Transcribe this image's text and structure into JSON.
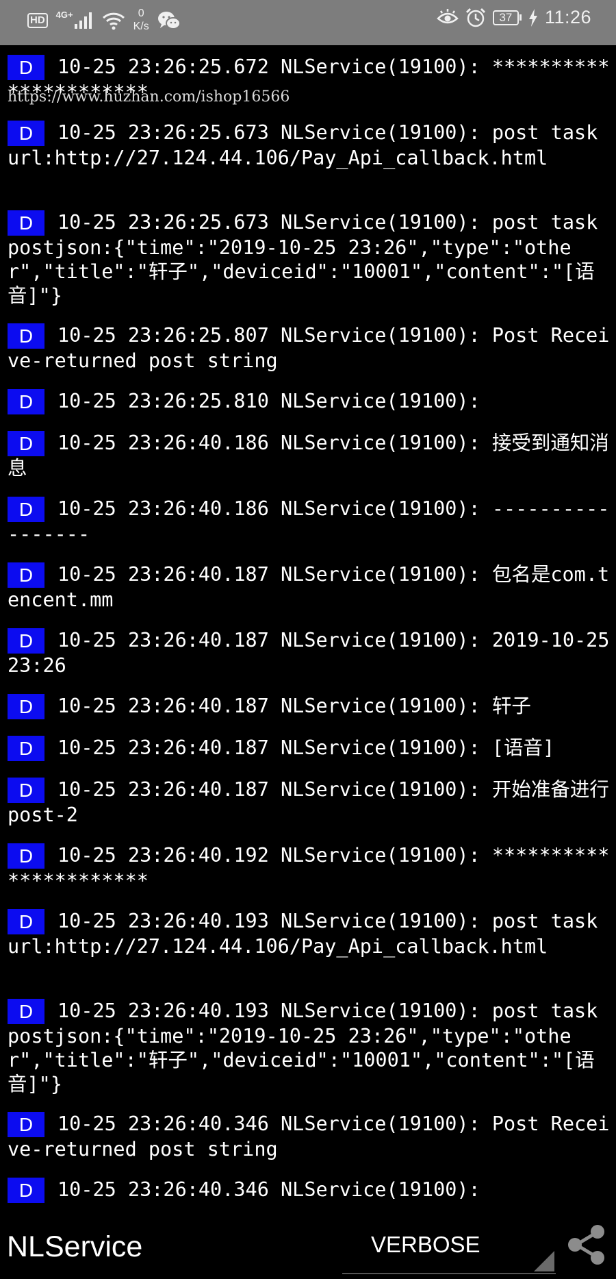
{
  "status_bar": {
    "hd_badge": "HD",
    "network_label": "4G+",
    "speed_value": "0",
    "speed_unit": "K/s",
    "battery": "37",
    "time": "11:26",
    "icons": [
      "signal-icon",
      "wifi-icon",
      "wechat-icon",
      "eye-comfort-icon",
      "alarm-icon",
      "battery-icon",
      "charging-icon"
    ]
  },
  "watermark": "https://www.huzhan.com/ishop16566",
  "log": {
    "entries": [
      {
        "level": "D",
        "message": "10-25 23:26:25.672 NLService(19100): **********************"
      },
      {
        "level": "D",
        "message": "10-25 23:26:25.673 NLService(19100): post task  url:http://27.124.44.106/Pay_Api_callback.html"
      },
      {
        "level": "D",
        "message": "10-25 23:26:25.673 NLService(19100): post task postjson:{\"time\":\"2019-10-25 23:26\",\"type\":\"other\",\"title\":\"轩子\",\"deviceid\":\"10001\",\"content\":\"[语音]\"}"
      },
      {
        "level": "D",
        "message": "10-25 23:26:25.807 NLService(19100): Post Receive-returned post string"
      },
      {
        "level": "D",
        "message": "10-25 23:26:25.810 NLService(19100):"
      },
      {
        "level": "D",
        "message": "10-25 23:26:40.186 NLService(19100): 接受到通知消息"
      },
      {
        "level": "D",
        "message": "10-25 23:26:40.186 NLService(19100): -----------------"
      },
      {
        "level": "D",
        "message": "10-25 23:26:40.187 NLService(19100): 包名是com.tencent.mm"
      },
      {
        "level": "D",
        "message": "10-25 23:26:40.187 NLService(19100): 2019-10-25 23:26"
      },
      {
        "level": "D",
        "message": "10-25 23:26:40.187 NLService(19100): 轩子"
      },
      {
        "level": "D",
        "message": "10-25 23:26:40.187 NLService(19100): [语音]"
      },
      {
        "level": "D",
        "message": "10-25 23:26:40.187 NLService(19100): 开始准备进行post-2"
      },
      {
        "level": "D",
        "message": "10-25 23:26:40.192 NLService(19100): **********************"
      },
      {
        "level": "D",
        "message": "10-25 23:26:40.193 NLService(19100): post task  url:http://27.124.44.106/Pay_Api_callback.html"
      },
      {
        "level": "D",
        "message": "10-25 23:26:40.193 NLService(19100): post task postjson:{\"time\":\"2019-10-25 23:26\",\"type\":\"other\",\"title\":\"轩子\",\"deviceid\":\"10001\",\"content\":\"[语音]\"}"
      },
      {
        "level": "D",
        "message": "10-25 23:26:40.346 NLService(19100): Post Receive-returned post string"
      },
      {
        "level": "D",
        "message": "10-25 23:26:40.346 NLService(19100):"
      }
    ]
  },
  "filter_bar": {
    "filter_value": "NLService",
    "level_selected": "VERBOSE"
  },
  "colors": {
    "level_badge": "#0c0cf0",
    "status_bar_bg": "#7d7d7d",
    "background": "#000000"
  }
}
